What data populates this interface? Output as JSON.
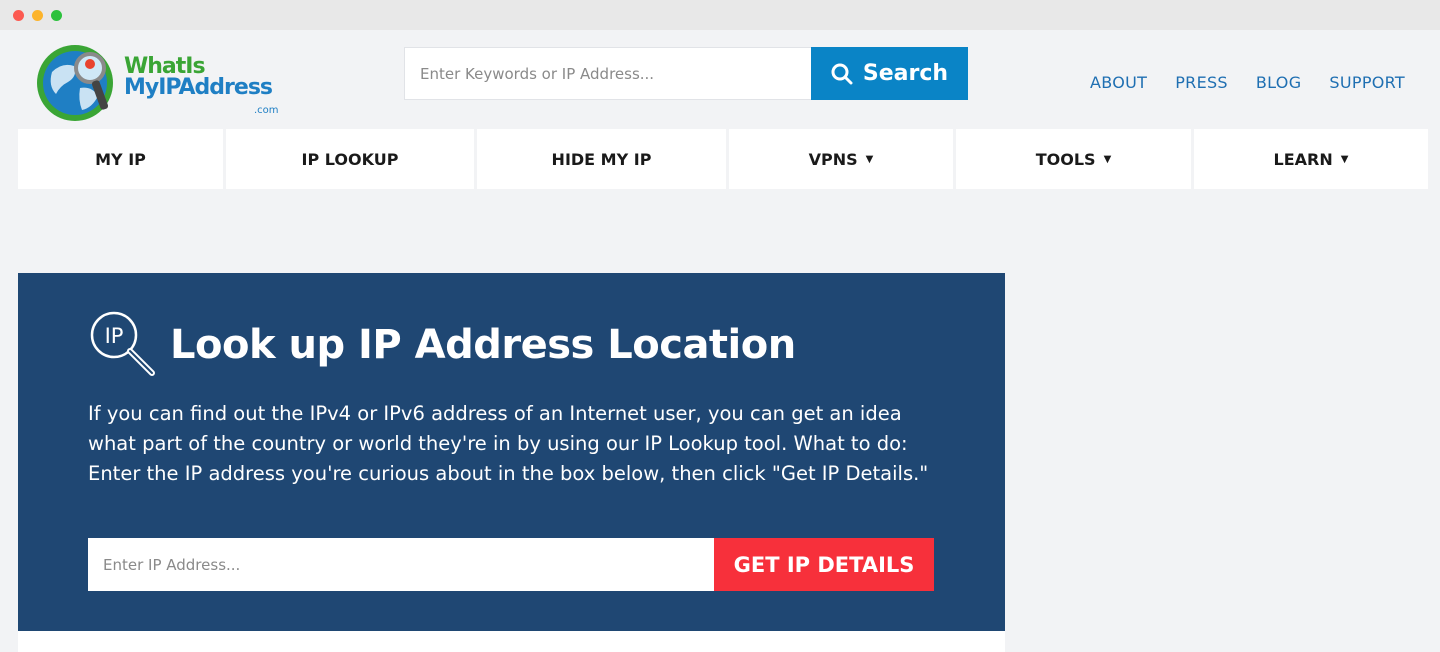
{
  "logo": {
    "line1": "WhatIs",
    "line2": "MyIPAddress",
    "tld": ".com"
  },
  "search": {
    "placeholder": "Enter Keywords or IP Address...",
    "button_label": "Search"
  },
  "top_links": [
    "ABOUT",
    "PRESS",
    "BLOG",
    "SUPPORT"
  ],
  "nav": [
    {
      "label": "MY IP",
      "caret": ""
    },
    {
      "label": "IP LOOKUP",
      "caret": ""
    },
    {
      "label": "HIDE MY IP",
      "caret": ""
    },
    {
      "label": "VPNS",
      "caret": "▼"
    },
    {
      "label": "TOOLS",
      "caret": "▼"
    },
    {
      "label": "LEARN",
      "caret": "▼"
    }
  ],
  "hero": {
    "icon_text": "IP",
    "title": "Look up IP Address Location",
    "description": "If you can find out the IPv4 or IPv6 address of an Internet user, you can get an idea what part of the country or world they're in by using our IP Lookup tool. What to do: Enter the IP address you're curious about in the box below, then click \"Get IP Details.\"",
    "input_placeholder": "Enter IP Address...",
    "button_label": "GET IP DETAILS"
  },
  "colors": {
    "accent_blue": "#0a84c6",
    "hero_bg": "#1f4773",
    "cta_red": "#f7303b",
    "link_blue": "#1f6fb2"
  }
}
